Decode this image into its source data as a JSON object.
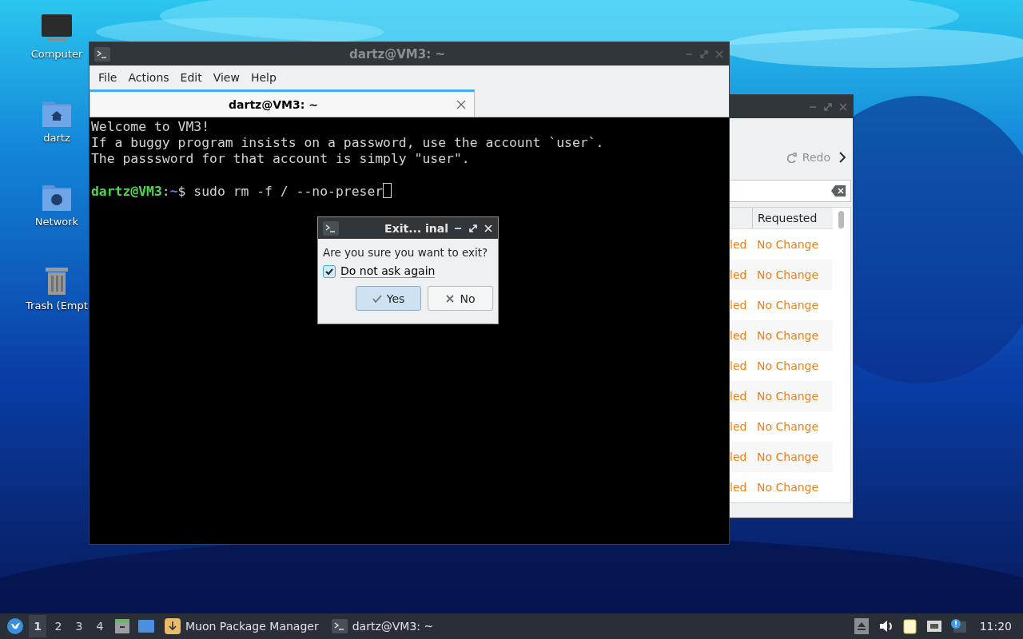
{
  "desktop_icons": [
    {
      "label": "Computer",
      "kind": "computer"
    },
    {
      "label": "dartz",
      "kind": "home"
    },
    {
      "label": "Network",
      "kind": "network"
    },
    {
      "label": "Trash (Empt",
      "kind": "trash"
    }
  ],
  "package_window": {
    "redo": "Redo",
    "column_header": "Requested",
    "rows": [
      {
        "column_1": "led",
        "requested": "No Change"
      },
      {
        "column_1": "led",
        "requested": "No Change"
      },
      {
        "column_1": "led",
        "requested": "No Change"
      },
      {
        "column_1": "led",
        "requested": "No Change"
      },
      {
        "column_1": "led",
        "requested": "No Change"
      },
      {
        "column_1": "led",
        "requested": "No Change"
      },
      {
        "column_1": "led",
        "requested": "No Change"
      },
      {
        "column_1": "led",
        "requested": "No Change"
      },
      {
        "column_1": "led",
        "requested": "No Change"
      }
    ]
  },
  "terminal": {
    "title": "dartz@VM3: ~",
    "menu": [
      "File",
      "Actions",
      "Edit",
      "View",
      "Help"
    ],
    "tabs": [
      {
        "label": "dartz@VM3: ~",
        "selected": true
      }
    ],
    "lines": [
      "Welcome to VM3!",
      "If a buggy program insists on a password, use the account `user`.",
      "The passsword for that account is simply \"user\"."
    ],
    "prompt": {
      "user": "dartz@VM3",
      "separator": ":",
      "path": "~",
      "symbol": "$ ",
      "command": "sudo rm -f / --no-preser"
    }
  },
  "dialog": {
    "title": "Exit... inal",
    "message": "Are you sure you want to exit?",
    "checkbox": {
      "label": "Do not ask again",
      "checked": true
    },
    "buttons": [
      {
        "label": "Yes",
        "kind": "yes",
        "selected": true
      },
      {
        "label": "No",
        "kind": "no",
        "selected": false
      }
    ]
  },
  "taskbar": {
    "workspaces": [
      {
        "label": "1",
        "selected": true
      },
      {
        "label": "2",
        "selected": false
      },
      {
        "label": "3",
        "selected": false
      },
      {
        "label": "4",
        "selected": false
      }
    ],
    "tasks": [
      {
        "label": "Muon Package Manager",
        "kind": "muon"
      },
      {
        "label": "dartz@VM3: ~",
        "kind": "terminal"
      }
    ],
    "clock": "11:20"
  }
}
